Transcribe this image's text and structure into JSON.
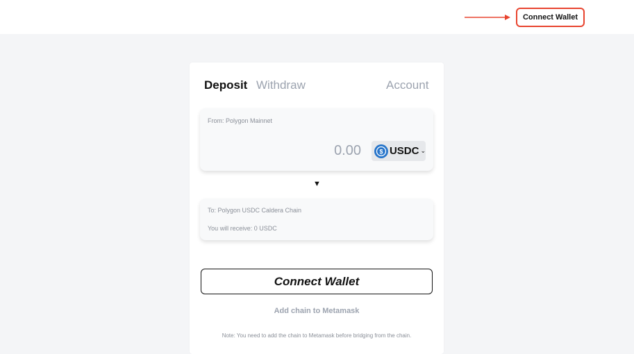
{
  "header": {
    "connect_wallet_label": "Connect Wallet",
    "annotation_arrow_color": "#e8432e"
  },
  "tabs": {
    "deposit": "Deposit",
    "withdraw": "Withdraw",
    "account": "Account"
  },
  "from_panel": {
    "label": "From: Polygon Mainnet",
    "amount": "0.00",
    "token": {
      "icon": "usdc-icon",
      "symbol": "USDC",
      "color": "#2775ca"
    }
  },
  "to_panel": {
    "label": "To: Polygon USDC Caldera Chain",
    "receive": "You will receive: 0 USDC"
  },
  "actions": {
    "connect_wallet_label": "Connect Wallet",
    "add_chain_label": "Add chain to Metamask"
  },
  "note": "Note: You need to add the chain to Metamask before bridging from the chain."
}
